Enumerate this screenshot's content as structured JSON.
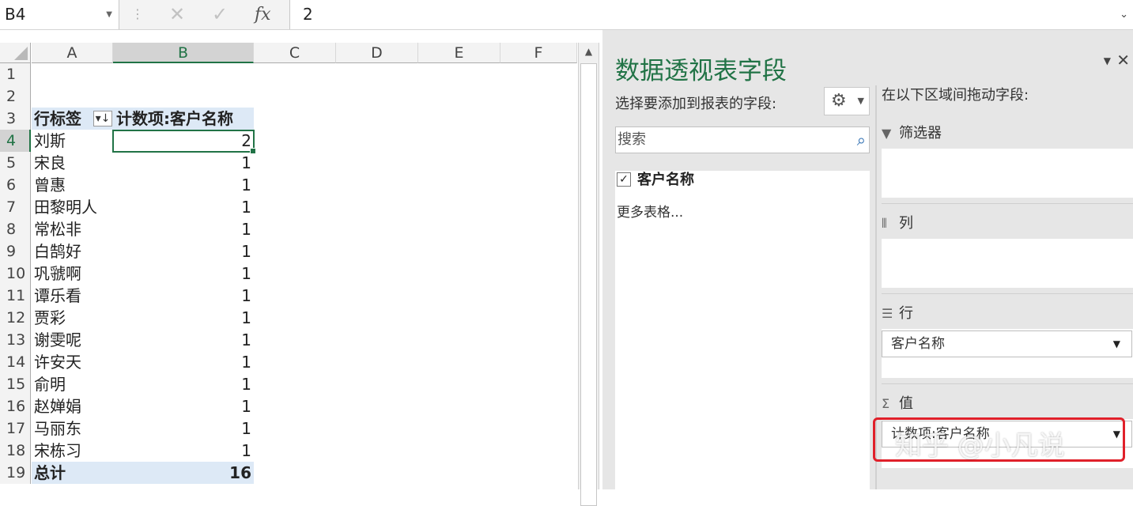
{
  "formula_bar": {
    "name_box": "B4",
    "cancel_glyph": "✕",
    "enter_glyph": "✓",
    "fx_label": "fx",
    "formula_value": "2"
  },
  "grid": {
    "columns": [
      "A",
      "B",
      "C",
      "D",
      "E",
      "F"
    ],
    "selected_column": "B",
    "rows": [
      {
        "num": "1",
        "a": "",
        "b": ""
      },
      {
        "num": "2",
        "a": "",
        "b": ""
      },
      {
        "num": "3",
        "a": "行标签",
        "b": "计数项:客户名称"
      },
      {
        "num": "4",
        "a": "刘斯",
        "b": "2"
      },
      {
        "num": "5",
        "a": "宋良",
        "b": "1"
      },
      {
        "num": "6",
        "a": "曾惠",
        "b": "1"
      },
      {
        "num": "7",
        "a": "田黎明人",
        "b": "1"
      },
      {
        "num": "8",
        "a": "常松非",
        "b": "1"
      },
      {
        "num": "9",
        "a": "白鹄好",
        "b": "1"
      },
      {
        "num": "10",
        "a": "巩虢啊",
        "b": "1"
      },
      {
        "num": "11",
        "a": "谭乐看",
        "b": "1"
      },
      {
        "num": "12",
        "a": "贾彩",
        "b": "1"
      },
      {
        "num": "13",
        "a": "谢雯呢",
        "b": "1"
      },
      {
        "num": "14",
        "a": "许安天",
        "b": "1"
      },
      {
        "num": "15",
        "a": "俞明",
        "b": "1"
      },
      {
        "num": "16",
        "a": "赵婵娟",
        "b": "1"
      },
      {
        "num": "17",
        "a": "马丽东",
        "b": "1"
      },
      {
        "num": "18",
        "a": "宋栋习",
        "b": "1"
      },
      {
        "num": "19",
        "a": "总计",
        "b": "16"
      }
    ]
  },
  "pivot_pane": {
    "title": "数据透视表字段",
    "choose_label": "选择要添加到报表的字段:",
    "search_placeholder": "搜索",
    "fields": [
      {
        "label": "客户名称",
        "checked": true
      }
    ],
    "more_tables": "更多表格...",
    "drag_label": "在以下区域间拖动字段:",
    "areas": {
      "filters": "筛选器",
      "columns": "列",
      "rows": "行",
      "values": "值"
    },
    "rows_field": "客户名称",
    "values_field": "计数项:客户名称"
  },
  "watermark": "知乎 @小凡说",
  "colors": {
    "accent": "#217346",
    "pivot_band": "#dde9f6",
    "highlight": "#e0202a"
  }
}
